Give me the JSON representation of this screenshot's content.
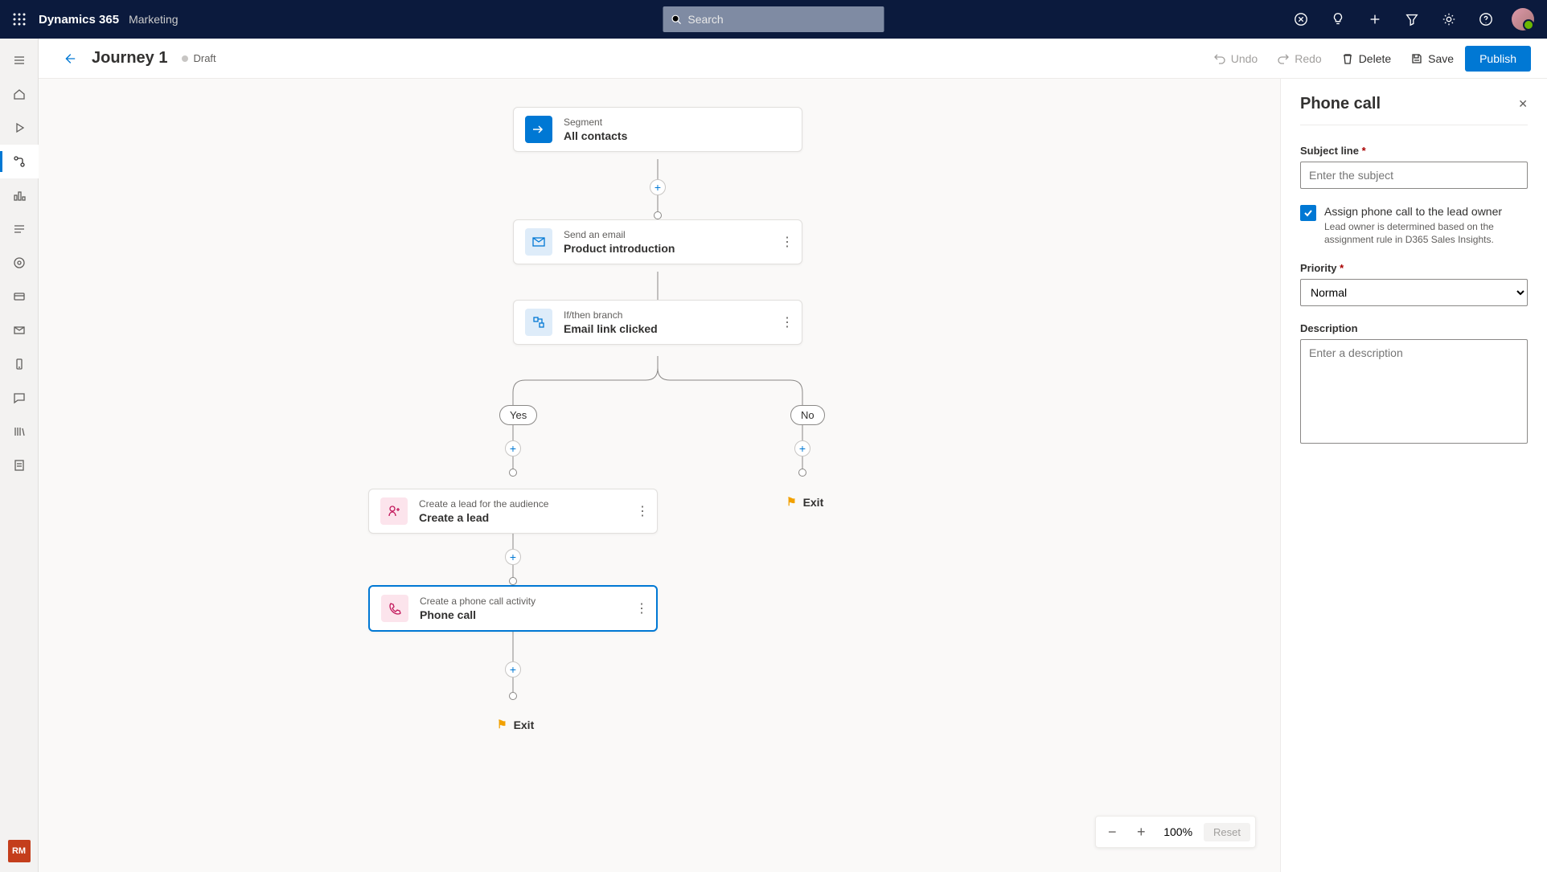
{
  "header": {
    "brand": "Dynamics 365",
    "module": "Marketing",
    "search_placeholder": "Search"
  },
  "cmdbar": {
    "title": "Journey 1",
    "status": "Draft",
    "undo": "Undo",
    "redo": "Redo",
    "delete": "Delete",
    "save": "Save",
    "publish": "Publish"
  },
  "nodes": {
    "segment": {
      "small": "Segment",
      "big": "All contacts"
    },
    "email": {
      "small": "Send an email",
      "big": "Product introduction"
    },
    "branch": {
      "small": "If/then branch",
      "big": "Email link clicked"
    },
    "yes": "Yes",
    "no": "No",
    "lead": {
      "small": "Create a lead for the audience",
      "big": "Create a lead"
    },
    "phone": {
      "small": "Create a phone call activity",
      "big": "Phone call"
    },
    "exit": "Exit"
  },
  "zoom": {
    "value": "100%",
    "reset": "Reset"
  },
  "panel": {
    "title": "Phone call",
    "subject_label": "Subject line",
    "subject_placeholder": "Enter the subject",
    "assign_label": "Assign phone call to the lead owner",
    "assign_hint": "Lead owner is determined based on the assignment rule in D365 Sales Insights.",
    "priority_label": "Priority",
    "priority_value": "Normal",
    "description_label": "Description",
    "description_placeholder": "Enter a description"
  },
  "rail_footer": "RM"
}
